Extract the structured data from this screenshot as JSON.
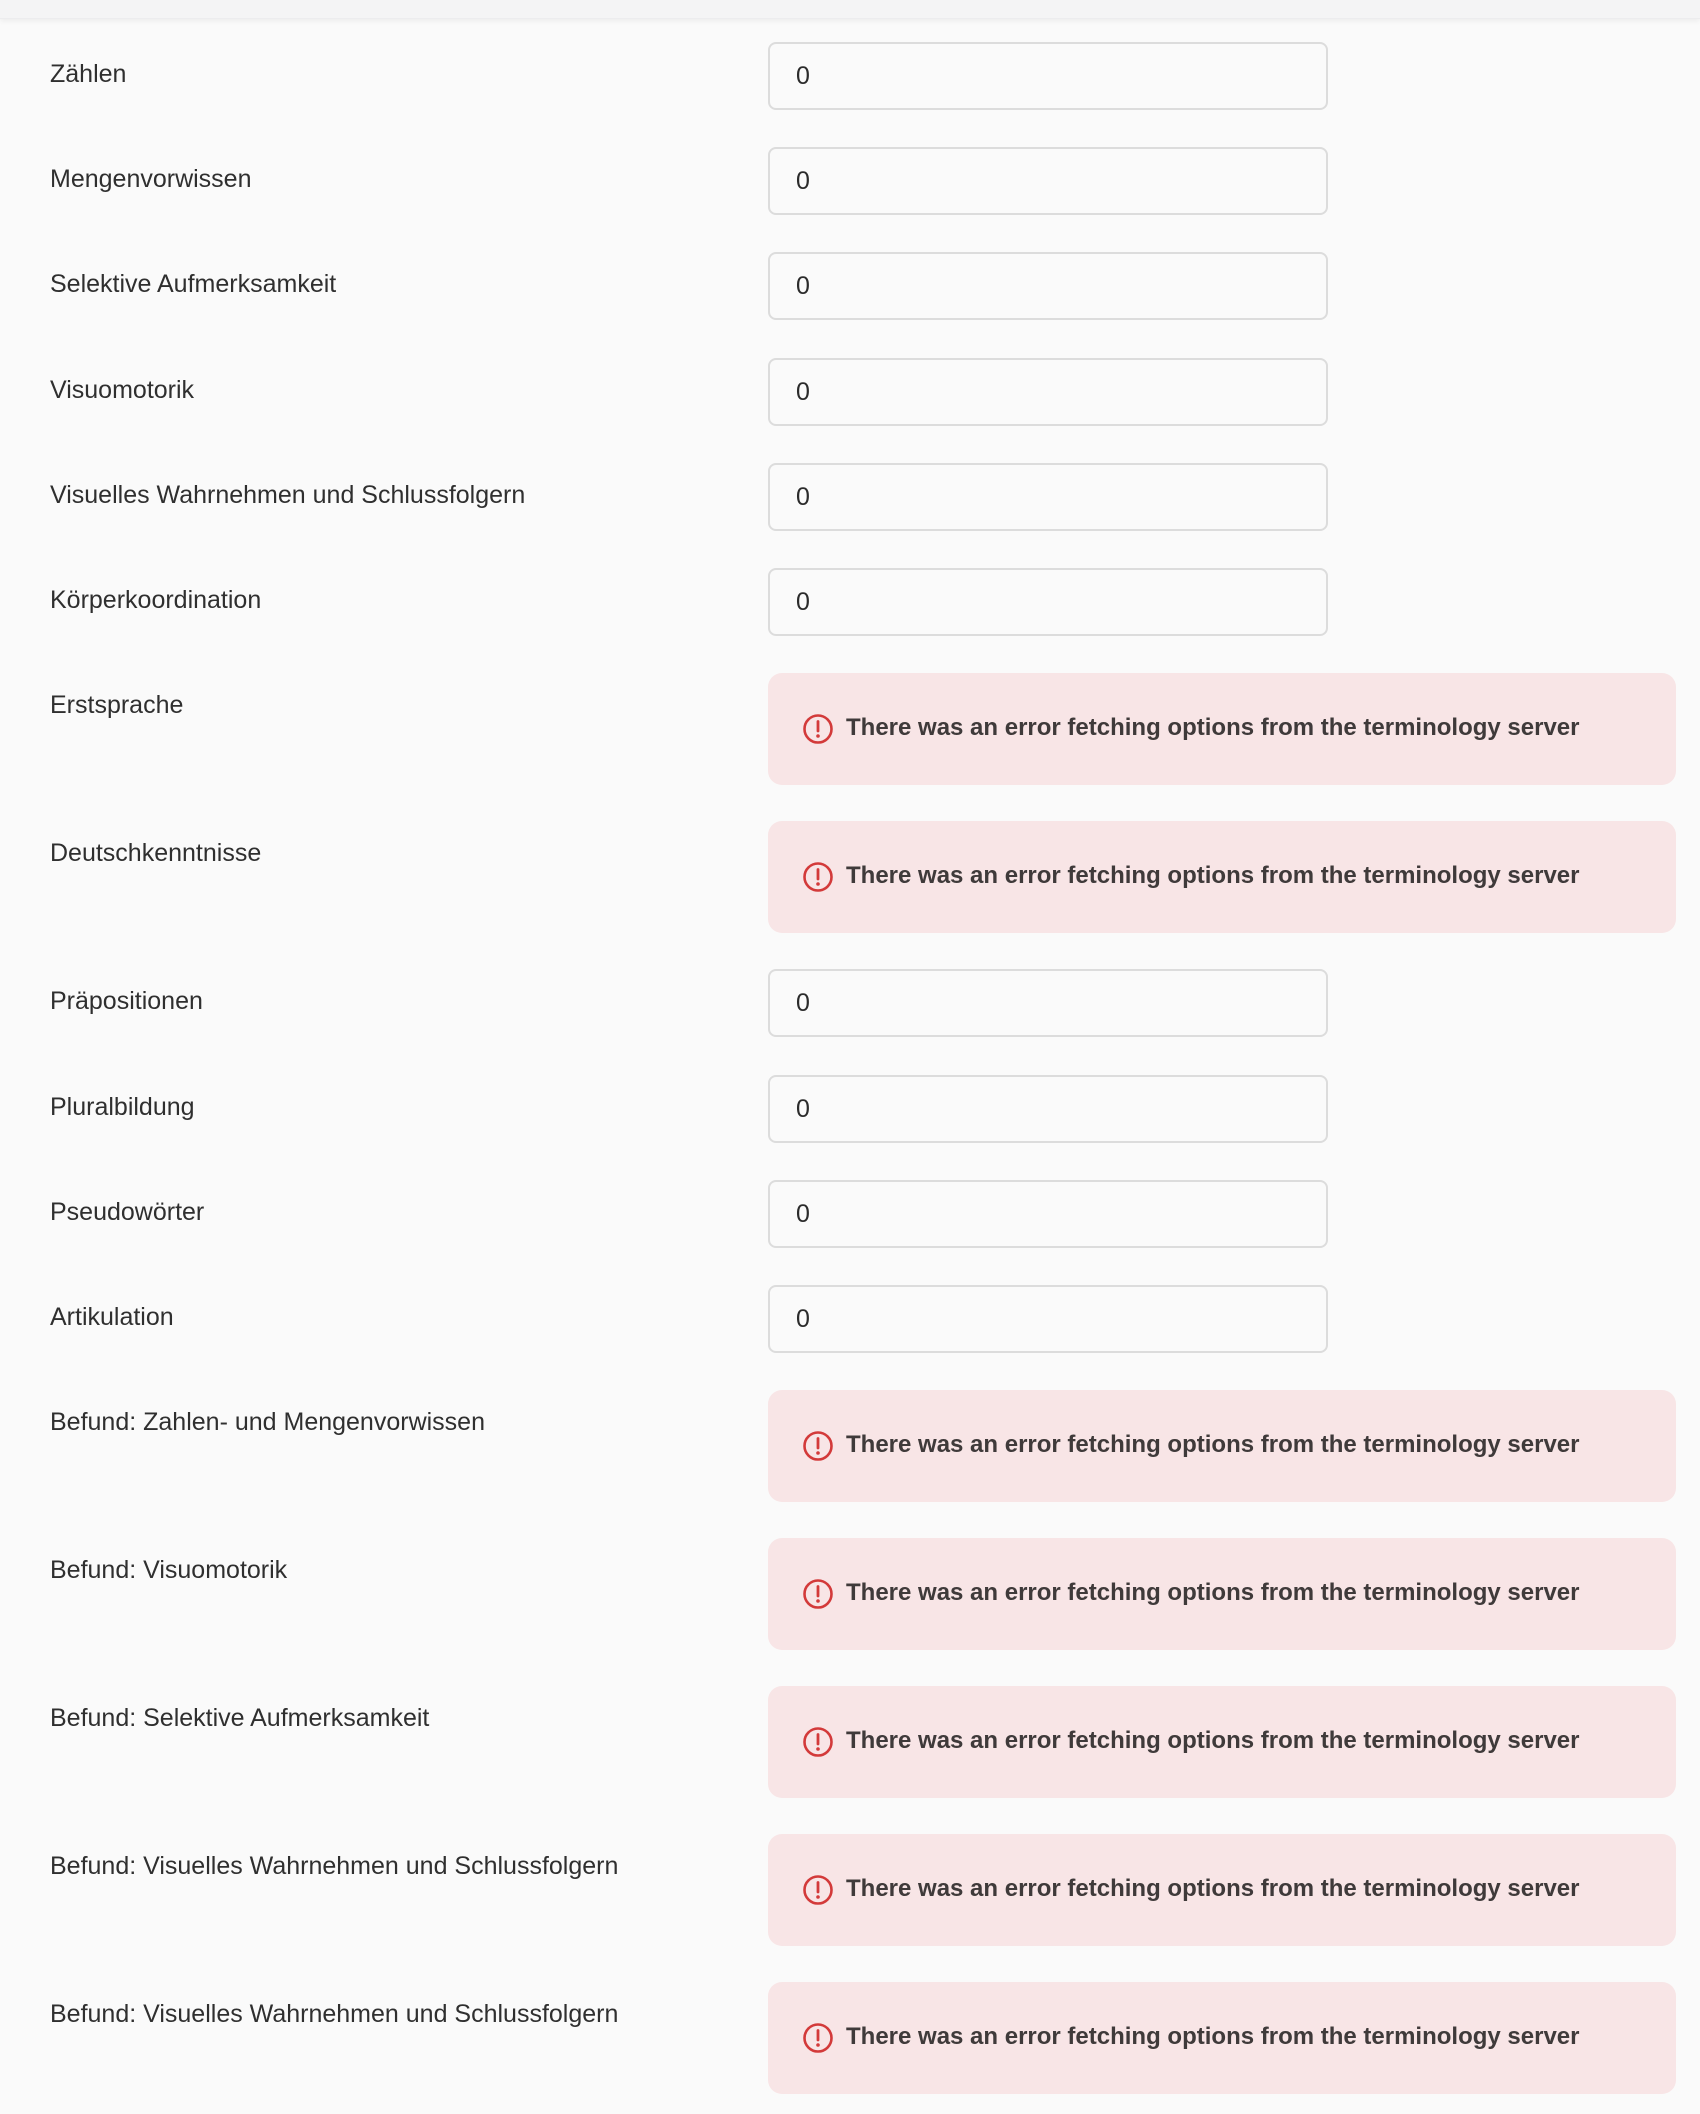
{
  "fields": [
    {
      "label": "Zählen",
      "type": "input",
      "value": "0"
    },
    {
      "label": "Mengenvorwissen",
      "type": "input",
      "value": "0"
    },
    {
      "label": "Selektive Aufmerksamkeit",
      "type": "input",
      "value": "0"
    },
    {
      "label": "Visuomotorik",
      "type": "input",
      "value": "0"
    },
    {
      "label": "Visuelles Wahrnehmen und Schlussfolgern",
      "type": "input",
      "value": "0"
    },
    {
      "label": "Körperkoordination",
      "type": "input",
      "value": "0"
    },
    {
      "label": "Erstsprache",
      "type": "error",
      "message": "There was an error fetching options from the terminology server"
    },
    {
      "label": "Deutschkenntnisse",
      "type": "error",
      "message": "There was an error fetching options from the terminology server"
    },
    {
      "label": "Präpositionen",
      "type": "input",
      "value": "0"
    },
    {
      "label": "Pluralbildung",
      "type": "input",
      "value": "0"
    },
    {
      "label": "Pseudowörter",
      "type": "input",
      "value": "0"
    },
    {
      "label": "Artikulation",
      "type": "input",
      "value": "0"
    },
    {
      "label": "Befund: Zahlen- und Mengenvorwissen",
      "type": "error",
      "message": "There was an error fetching options from the terminology server"
    },
    {
      "label": "Befund: Visuomotorik",
      "type": "error",
      "message": "There was an error fetching options from the terminology server"
    },
    {
      "label": "Befund: Selektive Aufmerksamkeit",
      "type": "error",
      "message": "There was an error fetching options from the terminology server"
    },
    {
      "label": "Befund: Visuelles Wahrnehmen und Schlussfolgern",
      "type": "error",
      "message": "There was an error fetching options from the terminology server"
    },
    {
      "label": "Befund: Visuelles Wahrnehmen und Schlussfolgern",
      "type": "error",
      "message": "There was an error fetching options from the terminology server"
    }
  ],
  "colors": {
    "error_background": "#f8e5e6",
    "error_icon": "#d33a3a",
    "input_border": "#dcdcdc"
  },
  "icons": {
    "error": "alert-circle-icon"
  }
}
